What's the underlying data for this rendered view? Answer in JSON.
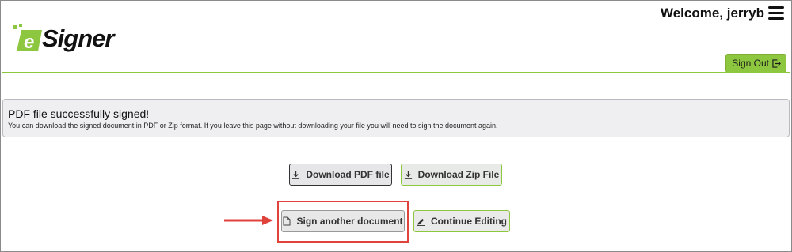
{
  "header": {
    "welcome_text": "Welcome, jerryb",
    "logo_text": "Signer",
    "logo_letter": "e",
    "sign_out_label": "Sign Out"
  },
  "alert": {
    "title": "PDF file successfully signed!",
    "message": "You can download the signed document in PDF or Zip format. If you leave this page without downloading your file you will need to sign the document again."
  },
  "actions": {
    "download_pdf_label": "Download PDF file",
    "download_zip_label": "Download Zip File",
    "sign_another_label": "Sign another document",
    "continue_editing_label": "Continue Editing"
  },
  "colors": {
    "brand_green": "#8dc63f",
    "annotation_red": "#e0423c"
  },
  "icons": [
    "menu-icon",
    "sign-out-icon",
    "download-icon",
    "document-icon",
    "pencil-icon",
    "arrow-icon"
  ]
}
